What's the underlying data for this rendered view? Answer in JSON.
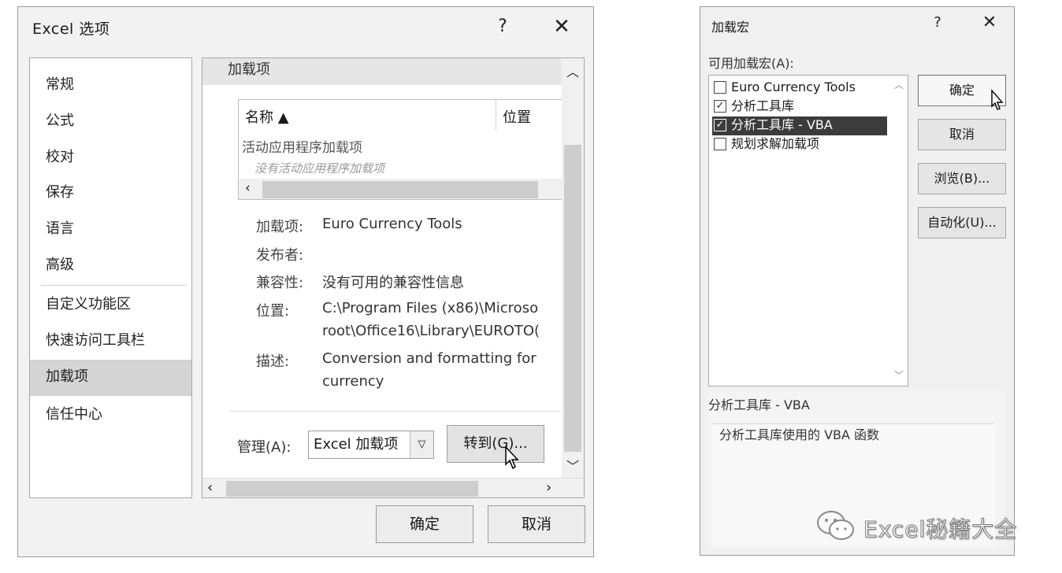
{
  "options_dialog": {
    "title": "Excel 选项",
    "help_icon": "?",
    "close_icon": "✕",
    "nav": [
      "常规",
      "公式",
      "校对",
      "保存",
      "语言",
      "高级",
      "自定义功能区",
      "快速访问工具栏",
      "加载项",
      "信任中心"
    ],
    "selected_nav": "加载项",
    "section_title": "加载项",
    "list": {
      "col_name": "名称 ▲",
      "col_location": "位置",
      "group": "活动应用程序加载项",
      "empty": "没有活动应用程序加载项"
    },
    "details": {
      "addin_label": "加载项:",
      "addin_value": "Euro Currency Tools",
      "publisher_label": "发布者:",
      "publisher_value": "",
      "compat_label": "兼容性:",
      "compat_value": "没有可用的兼容性信息",
      "location_label": "位置:",
      "location_value_1": "C:\\Program Files (x86)\\Microso",
      "location_value_2": "root\\Office16\\Library\\EUROTO(",
      "desc_label": "描述:",
      "desc_value_1": "Conversion and formatting for",
      "desc_value_2": "currency"
    },
    "manage_label": "管理(A):",
    "manage_value": "Excel 加载项",
    "goto_label": "转到(G)...",
    "ok_label": "确定",
    "cancel_label": "取消"
  },
  "addins_dialog": {
    "title": "加载宏",
    "help_icon": "?",
    "close_icon": "✕",
    "available_label": "可用加载宏(A):",
    "items": [
      {
        "label": "Euro Currency Tools",
        "checked": false,
        "mark": ""
      },
      {
        "label": "分析工具库",
        "checked": true,
        "mark": "✓"
      },
      {
        "label": "分析工具库 - VBA",
        "checked": true,
        "mark": "✓"
      },
      {
        "label": "规划求解加载项",
        "checked": false,
        "mark": ""
      }
    ],
    "selected_index": 2,
    "buttons": {
      "ok": "确定",
      "cancel": "取消",
      "browse": "浏览(B)...",
      "automation": "自动化(U)..."
    },
    "desc_title": "分析工具库 - VBA",
    "desc_text": "分析工具库使用的 VBA 函数"
  },
  "watermark": {
    "text": "Excel秘籍大全"
  }
}
